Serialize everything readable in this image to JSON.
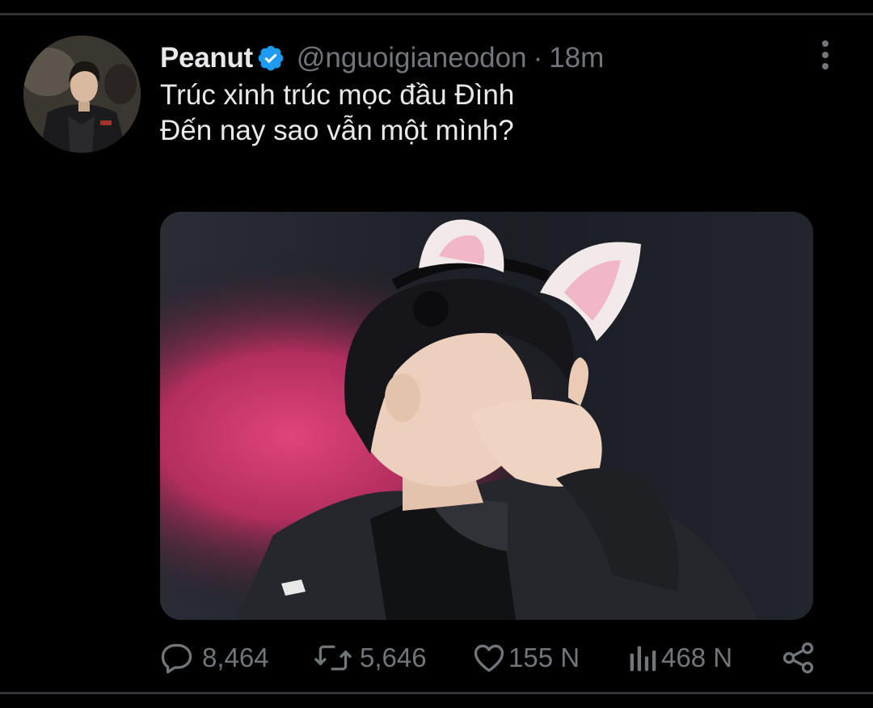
{
  "tweet": {
    "author": {
      "display_name": "Peanut",
      "handle": "@nguoigianeodon",
      "verified": true
    },
    "separator": "·",
    "timestamp": "18m",
    "text_lines": [
      "Trúc xinh trúc mọc đầu Đình",
      "Đến nay sao vẫn một mình?"
    ],
    "metrics": {
      "replies": "8,464",
      "retweets": "5,646",
      "likes": "155 N",
      "views": "468 N"
    }
  },
  "colors": {
    "background": "#000000",
    "text_primary": "#e7e9ea",
    "text_secondary": "#71767b",
    "verified_blue": "#1d9bf0",
    "divider": "#2f3336"
  },
  "icons": {
    "verified": "verified-badge-icon",
    "more": "more-options-icon",
    "reply": "reply-icon",
    "retweet": "retweet-icon",
    "like": "heart-icon",
    "views": "views-chart-icon",
    "share": "share-icon"
  }
}
